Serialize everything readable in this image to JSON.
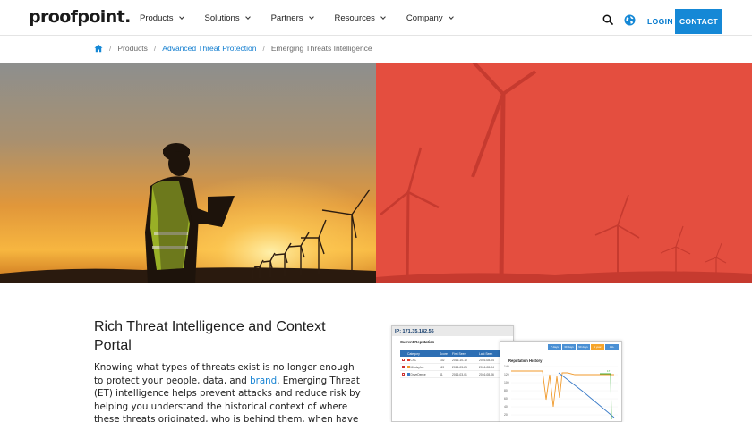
{
  "header": {
    "logo": "proofpoint.",
    "nav": [
      {
        "label": "Products"
      },
      {
        "label": "Solutions"
      },
      {
        "label": "Partners"
      },
      {
        "label": "Resources"
      },
      {
        "label": "Company"
      }
    ],
    "login_label": "LOGIN",
    "contact_label": "CONTACT",
    "colors": {
      "accent": "#1588d6",
      "link": "#0f7ccf"
    }
  },
  "breadcrumb": {
    "items": [
      "Products",
      "Advanced Threat Protection",
      "Emerging Threats Intelligence"
    ]
  },
  "hero": {
    "icons": [
      "engineer-with-laptop-photo",
      "wind-turbines-photo"
    ],
    "colors": {
      "left_tint": "#e0872f",
      "right_tint": "#e1483b"
    }
  },
  "content": {
    "title": "Rich Threat Intelligence and Context Portal",
    "paragraph_before_link1": "Knowing what types of threats exist is no longer enough to protect your people, data, and ",
    "link1": "brand",
    "paragraph_after_link1": ". Emerging Threat (ET) intelligence helps prevent attacks and reduce risk by helping you understand the historical context of where these threats originated, who is behind them, when have"
  },
  "dashboard": {
    "ip_label": "IP: 171.35.182.56",
    "current_reputation_label": "Current Reputation",
    "table_headers": [
      "Category",
      "Score",
      "First Seen",
      "Last Seen"
    ],
    "rows": [
      {
        "category": "CnC",
        "score": "102",
        "first": "2016-10-10",
        "last": "2016-08-04"
      },
      {
        "category": "Mindsyfox",
        "score": "119",
        "first": "2016-03-25",
        "last": "2016-08-04"
      },
      {
        "category": "DriveDence",
        "score": "41",
        "first": "2016-03-01",
        "last": "2016-08-06"
      }
    ],
    "range_tabs": [
      "7 days",
      "30 days",
      "90 days",
      "1 year",
      "ALL"
    ],
    "active_tab": "1 year",
    "reputation_history_label": "Reputation History",
    "y_ticks": [
      "140",
      "120",
      "100",
      "80",
      "60",
      "40",
      "20"
    ],
    "series_colors": [
      "#f09a2b",
      "#3a7bc8",
      "#3cae3a"
    ]
  }
}
